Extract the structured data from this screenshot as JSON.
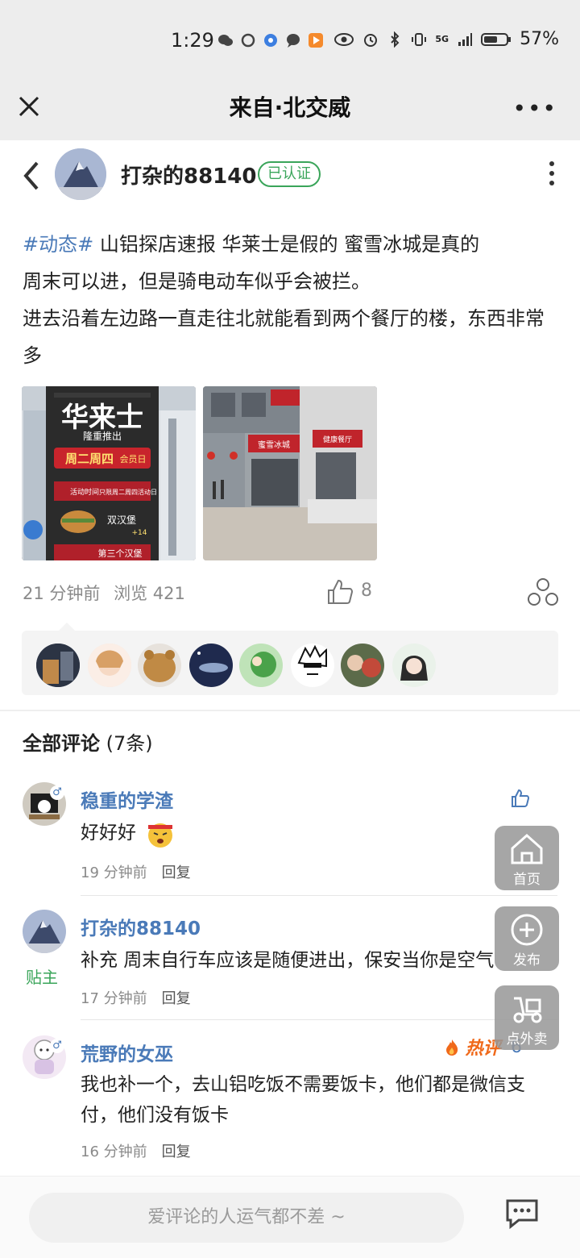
{
  "status_bar": {
    "time": "1:29",
    "battery": "57%",
    "signal_label": "5G",
    "icons": [
      "wechat-icon",
      "circle-icon",
      "browser-icon",
      "message-icon",
      "video-icon",
      "eye-icon",
      "alarm-icon",
      "bluetooth-icon",
      "vibrate-icon",
      "signal-icon",
      "battery-icon"
    ]
  },
  "titlebar": {
    "title": "来自·北交威",
    "more": "•••"
  },
  "post": {
    "author": "打杂的88140",
    "verified_label": "已认证",
    "hashtag": "#动态#",
    "line1": " 山铝探店速报 华莱士是假的 蜜雪冰城是真的",
    "line2": "周末可以进，但是骑电动车似乎会被拦。",
    "line3": "进去沿着左边路一直走往北就能看到两个餐厅的楼，东西非常多",
    "time_ago": "21 分钟前",
    "views_label": "浏览 421",
    "like_count": "8",
    "image1": {
      "title": "华来士",
      "subtitle": "隆重推出",
      "promo": "周二周四",
      "promo_tag": "会员日",
      "activity": "活动时间",
      "activity_value": "只限周二周四活动日",
      "item1": "双汉堡",
      "item1_tag": "+14",
      "item2": "第三个汉堡"
    },
    "image2": {
      "sign1": "蜜雪冰城",
      "sign2": "健康餐厅"
    }
  },
  "likers_count": 8,
  "comments_header": {
    "label": "全部评论",
    "count": "(7条)"
  },
  "comments": [
    {
      "name": "稳重的学渣",
      "gender": "♂",
      "text": "好好好",
      "time": "19 分钟前",
      "reply": "回复",
      "badge": ""
    },
    {
      "name": "打杂的88140",
      "gender": "",
      "text": "补充 周末自行车应该是随便进出，保安当你是空气",
      "time": "17 分钟前",
      "reply": "回复",
      "badge": "贴主"
    },
    {
      "name": "荒野的女巫",
      "gender": "♂",
      "text": "我也补一个，去山铝吃饭不需要饭卡，他们都是微信支付，他们没有饭卡",
      "time": "16 分钟前",
      "reply": "回复",
      "badge": "",
      "hot_label": "热评",
      "like_count": "6"
    }
  ],
  "fab": {
    "home": "首页",
    "publish": "发布",
    "takeout": "点外卖"
  },
  "bottom": {
    "placeholder": "爱评论的人运气都不差 ~"
  },
  "colors": {
    "link": "#4a7ab8",
    "verified": "#3aa55a",
    "hot": "#f0691a"
  }
}
